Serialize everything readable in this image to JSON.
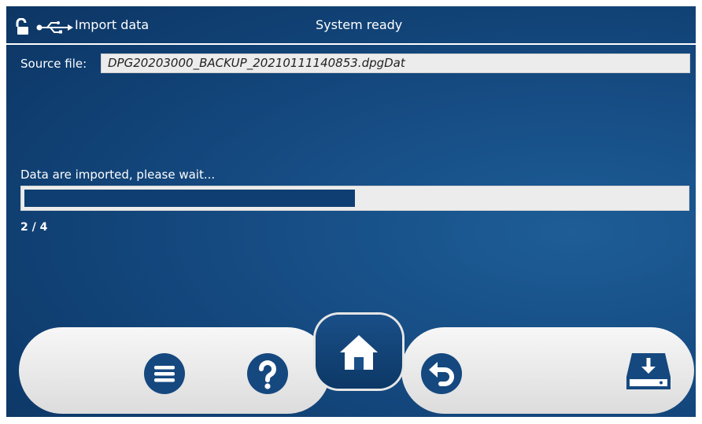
{
  "header": {
    "title": "Import data",
    "status": "System ready"
  },
  "source": {
    "label": "Source file:",
    "value": "DPG20203000_BACKUP_20210111140853.dpgDat"
  },
  "progress": {
    "message": "Data are imported, please wait...",
    "counter": "2 / 4",
    "fraction": 0.5
  },
  "icons": {
    "lock": "unlocked-padlock-icon",
    "usb": "usb-icon",
    "menu": "menu-icon",
    "help": "help-icon",
    "home": "home-icon",
    "back": "undo-icon",
    "save": "drive-download-icon"
  },
  "colors": {
    "background": "#14497f",
    "accent": "#0f3f72",
    "dock": "#ececec"
  }
}
